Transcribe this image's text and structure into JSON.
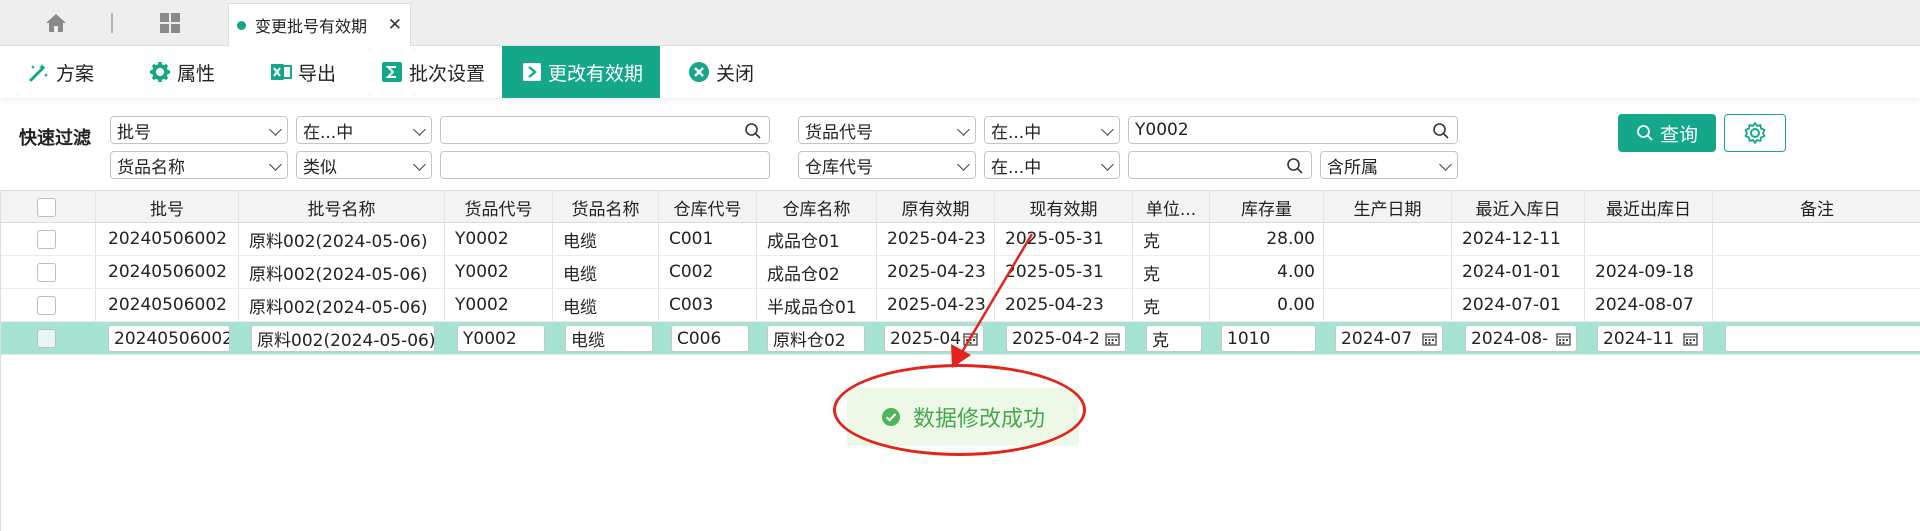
{
  "tabbar": {
    "doc_tab_label": "变更批号有效期",
    "close_glyph": "✕"
  },
  "toolbar": {
    "items": [
      {
        "label": "方案",
        "icon": "scheme-icon"
      },
      {
        "label": "属性",
        "icon": "gear-icon"
      },
      {
        "label": "导出",
        "icon": "excel-icon"
      },
      {
        "label": "批次设置",
        "icon": "sigma-icon"
      },
      {
        "label": "更改有效期",
        "icon": "arrow-right-icon",
        "active": true
      },
      {
        "label": "关闭",
        "icon": "close-circle-icon"
      }
    ]
  },
  "filters": {
    "label": "快速过滤",
    "row1": {
      "field1": "批号",
      "op1": "在...中",
      "value1": "",
      "field2": "货品代号",
      "op2": "在...中",
      "value2": "Y0002"
    },
    "row2": {
      "field1": "货品名称",
      "op1": "类似",
      "value1": "",
      "field2": "仓库代号",
      "op2": "在...中",
      "value2": "",
      "sub_option": "含所属"
    },
    "query_label": "查询"
  },
  "grid": {
    "columns": [
      "批号",
      "批号名称",
      "货品代号",
      "货品名称",
      "仓库代号",
      "仓库名称",
      "原有效期",
      "现有效期",
      "单位...",
      "库存量",
      "生产日期",
      "最近入库日",
      "最近出库日",
      "备注"
    ],
    "rows": [
      {
        "batch": "20240506002",
        "batch_name": "原料002(2024-05-06)",
        "code": "Y0002",
        "name": "电缆",
        "wh_code": "C001",
        "wh_name": "成品仓01",
        "old_exp": "2025-04-23",
        "new_exp": "2025-05-31",
        "unit": "克",
        "qty": "28.00",
        "prod_date": "",
        "last_in": "2024-12-11",
        "last_out": "",
        "note": ""
      },
      {
        "batch": "20240506002",
        "batch_name": "原料002(2024-05-06)",
        "code": "Y0002",
        "name": "电缆",
        "wh_code": "C002",
        "wh_name": "成品仓02",
        "old_exp": "2025-04-23",
        "new_exp": "2025-05-31",
        "unit": "克",
        "qty": "4.00",
        "prod_date": "",
        "last_in": "2024-01-01",
        "last_out": "2024-09-18",
        "note": ""
      },
      {
        "batch": "20240506002",
        "batch_name": "原料002(2024-05-06)",
        "code": "Y0002",
        "name": "电缆",
        "wh_code": "C003",
        "wh_name": "半成品仓01",
        "old_exp": "2025-04-23",
        "new_exp": "2025-04-23",
        "unit": "克",
        "qty": "0.00",
        "prod_date": "",
        "last_in": "2024-07-01",
        "last_out": "2024-08-07",
        "note": ""
      }
    ],
    "edit_row": {
      "batch": "20240506002",
      "batch_name": "原料002(2024-05-06)",
      "code": "Y0002",
      "name": "电缆",
      "wh_code": "C006",
      "wh_name": "原料仓02",
      "old_exp": "2025-04",
      "new_exp": "2025-04-2",
      "unit": "克",
      "qty": "1010",
      "prod_date": "2024-07",
      "last_in": "2024-08-",
      "last_out": "2024-11",
      "note": ""
    }
  },
  "toast": {
    "message": "数据修改成功",
    "color": "#46a84f"
  },
  "colors": {
    "accent": "#15a78a",
    "edit_row": "#a6e3d3",
    "annotation": "#e3241b"
  }
}
